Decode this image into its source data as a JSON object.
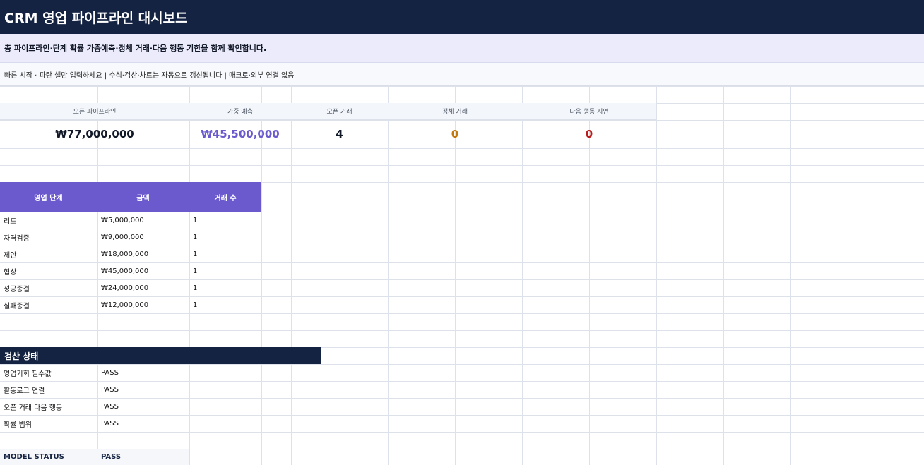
{
  "header": {
    "title": "CRM 영업 파이프라인 대시보드"
  },
  "subtitle": "총 파이프라인·단계 확률 가중예측·정체 거래·다음 행동 기한을 함께 확인합니다.",
  "notes": "빠른 시작 · 파란 셀만 입력하세요  |  수식·검산·차트는 자동으로 갱신됩니다  |  매크로·외부 연결 없음",
  "kpis": [
    {
      "label": "오픈 파이프라인",
      "value": "₩77,000,000",
      "color": "#111827"
    },
    {
      "label": "가중 예측",
      "value": "₩45,500,000",
      "color": "#6a5acd"
    },
    {
      "label": "오픈 거래",
      "value": "4",
      "color": "#111827"
    },
    {
      "label": "정체 거래",
      "value": "0",
      "color": "#c2780a"
    },
    {
      "label": "다음 행동 지연",
      "value": "0",
      "color": "#b91c1c"
    }
  ],
  "stage_table": {
    "headers": [
      "영업 단계",
      "금액",
      "거래 수"
    ],
    "rows": [
      {
        "stage": "리드",
        "amount": "₩5,000,000",
        "count": "1"
      },
      {
        "stage": "자격검증",
        "amount": "₩9,000,000",
        "count": "1"
      },
      {
        "stage": "제안",
        "amount": "₩18,000,000",
        "count": "1"
      },
      {
        "stage": "협상",
        "amount": "₩45,000,000",
        "count": "1"
      },
      {
        "stage": "성공종결",
        "amount": "₩24,000,000",
        "count": "1"
      },
      {
        "stage": "실패종결",
        "amount": "₩12,000,000",
        "count": "1"
      }
    ]
  },
  "checks": {
    "title": "검산 상태",
    "rows": [
      {
        "label": "영업기회 필수값",
        "value": "PASS"
      },
      {
        "label": "활동로그 연결",
        "value": "PASS"
      },
      {
        "label": "오픈 거래 다음 행동",
        "value": "PASS"
      },
      {
        "label": "확률 범위",
        "value": "PASS"
      }
    ],
    "model_label": "MODEL STATUS",
    "model_value": "PASS"
  }
}
